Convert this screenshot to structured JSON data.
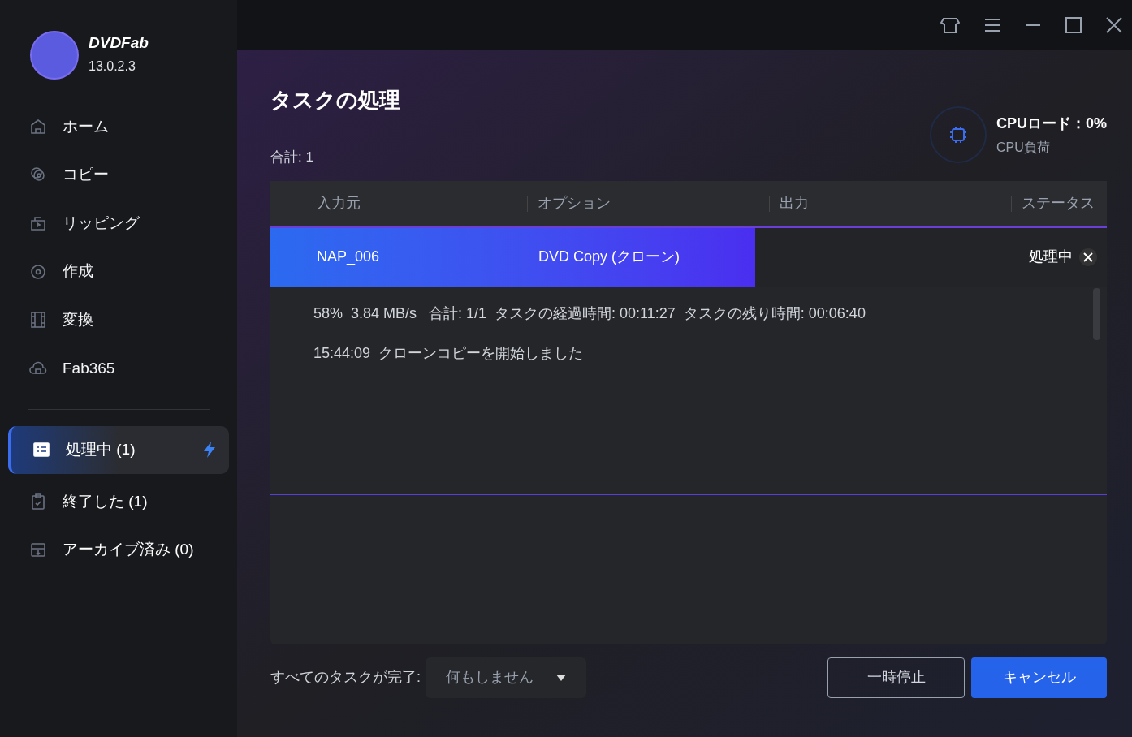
{
  "app": {
    "name": "DVDFab",
    "version": "13.0.2.3"
  },
  "nav": [
    {
      "label": "ホーム",
      "selected": false
    },
    {
      "label": "コピー",
      "selected": false
    },
    {
      "label": "リッピング",
      "selected": false
    },
    {
      "label": "作成",
      "selected": false
    },
    {
      "label": "変換",
      "selected": false
    },
    {
      "label": "Fab365",
      "selected": false
    }
  ],
  "queues": [
    {
      "label": "処理中 (1)",
      "selected": true,
      "boost": true
    },
    {
      "label": "終了した (1)",
      "selected": false,
      "boost": false
    },
    {
      "label": "アーカイブ済み (0)",
      "selected": false,
      "boost": false
    }
  ],
  "page": {
    "title": "タスクの処理",
    "total": "合計: 1"
  },
  "cpu": {
    "label": "CPUロード：0%",
    "caption": "CPU負荷"
  },
  "table": {
    "columns": [
      "入力元",
      "オプション",
      "出力",
      "ステータス"
    ],
    "rows": [
      {
        "source": "NAP_006",
        "option": "DVD Copy (クローン)",
        "status": "処理中",
        "level": 0.58
      }
    ]
  },
  "log": [
    "58%  3.84 MB/s   合計: 1/1  タスクの経過時間: 00:11:27  タスクの残り時間: 00:06:40",
    "15:44:09  クローンコピーを開始しました"
  ],
  "footer": {
    "label": "すべてのタスクが完了:",
    "dropdown": "何もしません",
    "pause": "一時停止",
    "cancel": "キャンセル"
  }
}
